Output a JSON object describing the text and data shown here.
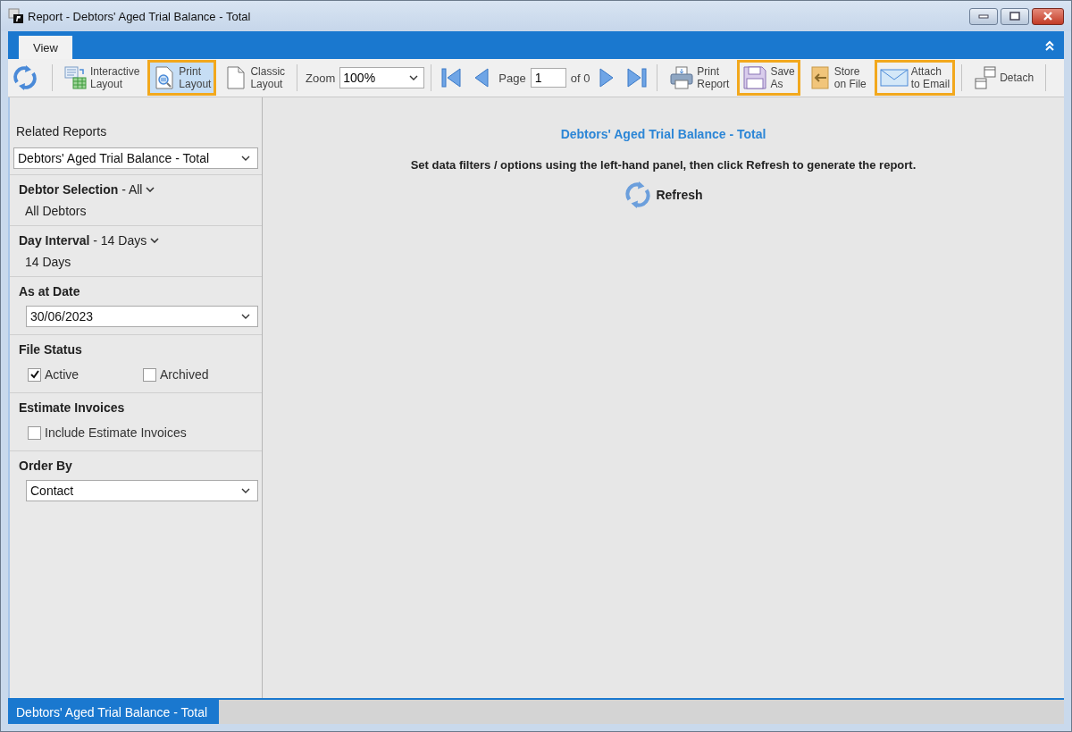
{
  "window": {
    "title": "Report - Debtors' Aged Trial Balance - Total"
  },
  "ribbon_tabs": [
    {
      "label": "View",
      "selected": true
    }
  ],
  "toolbar": {
    "layouts": [
      {
        "lines": [
          "Interactive",
          "Layout"
        ],
        "selected": false,
        "highlighted": false
      },
      {
        "lines": [
          "Print",
          "Layout"
        ],
        "selected": true,
        "highlighted": true
      },
      {
        "lines": [
          "Classic",
          "Layout"
        ],
        "selected": false,
        "highlighted": false
      }
    ],
    "zoom": {
      "label": "Zoom",
      "value": "100%"
    },
    "pager": {
      "label": "Page",
      "value": "1",
      "total": "of 0"
    },
    "actions": [
      {
        "lines": [
          "Print",
          "Report"
        ],
        "highlighted": false
      },
      {
        "lines": [
          "Save",
          "As"
        ],
        "highlighted": true
      },
      {
        "lines": [
          "Store",
          "on File"
        ],
        "highlighted": false
      },
      {
        "lines": [
          "Attach",
          "to Email"
        ],
        "highlighted": true
      }
    ],
    "detach": {
      "label": "Detach"
    }
  },
  "sidebar": {
    "related_reports": {
      "label": "Related Reports",
      "value": "Debtors' Aged Trial Balance - Total"
    },
    "sections": [
      {
        "kind": "summary",
        "heading": "**Debtor Selection** - All",
        "value": "All Debtors"
      },
      {
        "kind": "summary",
        "heading": "**Day Interval** - 14 Days",
        "value": "14 Days"
      },
      {
        "kind": "select",
        "heading": "As at Date",
        "value": "30/06/2023"
      },
      {
        "kind": "checkboxes",
        "heading": "File Status",
        "options": [
          {
            "label": "Active",
            "checked": true
          },
          {
            "label": "Archived",
            "checked": false
          }
        ]
      },
      {
        "kind": "checkboxes",
        "heading": "Estimate Invoices",
        "options": [
          {
            "label": "Include Estimate Invoices",
            "checked": false
          }
        ]
      },
      {
        "kind": "select",
        "heading": "Order By",
        "value": "Contact"
      }
    ]
  },
  "report": {
    "title": "Debtors' Aged Trial Balance - Total",
    "message": "Set data filters / options using the left-hand panel, then click Refresh to generate the report.",
    "refresh": "Refresh"
  },
  "bottom_tabs": [
    {
      "label": "Debtors' Aged Trial Balance - Total",
      "selected": true
    }
  ]
}
